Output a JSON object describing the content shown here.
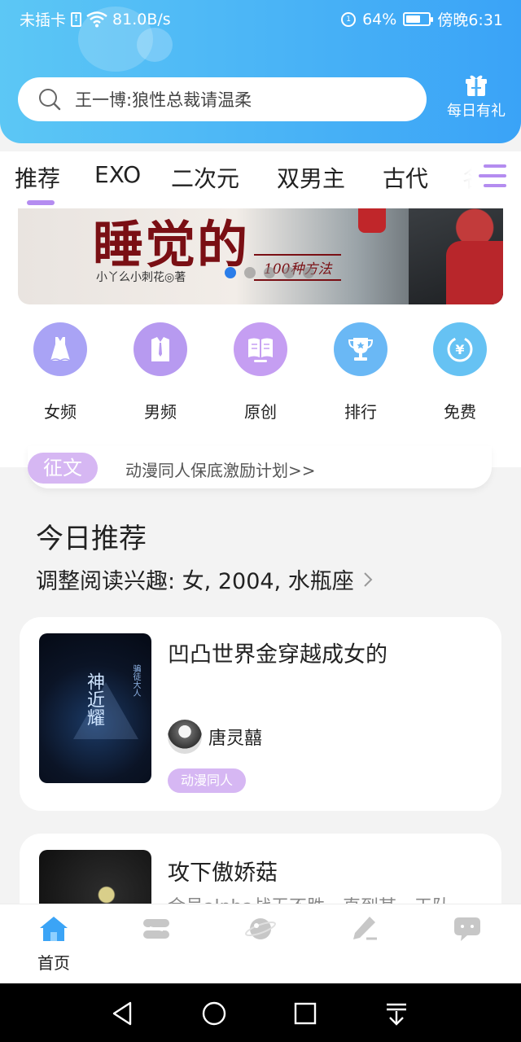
{
  "status_bar": {
    "carrier": "未插卡",
    "sim_icon_text": "!",
    "network_speed": "81.0B/s",
    "battery_percent": "64%",
    "battery_level": 0.64,
    "time": "傍晚6:31"
  },
  "search": {
    "text": "王一博:狼性总裁请温柔"
  },
  "daily_gift": {
    "label": "每日有礼",
    "icon": "gift-icon"
  },
  "tabs": {
    "items": [
      "推荐",
      "EXO",
      "二次元",
      "双男主",
      "古代",
      "名"
    ],
    "active_index": 0,
    "menu_icon": "menu-icon"
  },
  "banner": {
    "title": "睡觉的",
    "subtitle": "100种方法",
    "author": "小丫么小刺花◎著",
    "slide_count": 5,
    "active_slide": 0
  },
  "categories": [
    {
      "label": "女频",
      "icon": "dress-icon",
      "color": "#a9a3f5"
    },
    {
      "label": "男频",
      "icon": "shirt-icon",
      "color": "#b79af0"
    },
    {
      "label": "原创",
      "icon": "book-icon",
      "color": "#c59ef2"
    },
    {
      "label": "排行",
      "icon": "trophy-icon",
      "color": "#6ab8f5"
    },
    {
      "label": "免费",
      "icon": "coin-icon",
      "color": "#66c2f3"
    }
  ],
  "notice": {
    "badge": "征文",
    "text": "动漫同人保底激励计划>>"
  },
  "section": {
    "title": "今日推荐",
    "subtitle": "调整阅读兴趣: 女, 2004, 水瓶座"
  },
  "books": [
    {
      "title": "凹凸世界金穿越成女的",
      "cover_title": "神近耀",
      "cover_note": "骗徒大人",
      "author": "唐灵囍",
      "tag": "动漫同人"
    },
    {
      "title": "攻下傲娇菇",
      "description": "金号alpha战无不胜，直到某一天队"
    }
  ],
  "bottom_nav": [
    {
      "label": "首页",
      "icon": "home-icon",
      "active": true
    },
    {
      "label": "",
      "icon": "library-icon",
      "active": false
    },
    {
      "label": "",
      "icon": "planet-icon",
      "active": false
    },
    {
      "label": "",
      "icon": "pen-icon",
      "active": false
    },
    {
      "label": "",
      "icon": "message-icon",
      "active": false
    }
  ],
  "colors": {
    "header_start": "#5cc7f5",
    "header_end": "#3aa3f7",
    "accent_purple": "#d6b7f3",
    "tab_indicator": "#b48cf0",
    "active_dot": "#2b7de9"
  }
}
